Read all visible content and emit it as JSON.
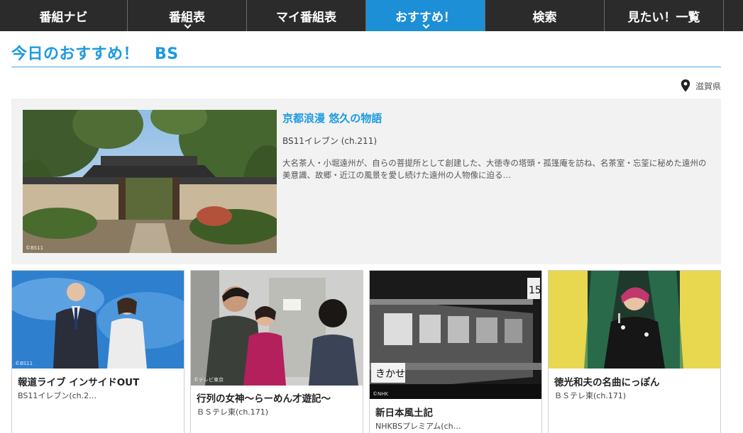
{
  "nav": {
    "items": [
      {
        "label": "番組ナビ"
      },
      {
        "label": "番組表"
      },
      {
        "label": "マイ番組表"
      },
      {
        "label": "おすすめ！"
      },
      {
        "label": "検索"
      },
      {
        "label": "見たい！一覧"
      }
    ]
  },
  "page": {
    "title": "今日のおすすめ！",
    "subtitle": "BS"
  },
  "location": {
    "label": "滋賀県"
  },
  "featured": {
    "title": "京都浪漫 悠久の物語",
    "channel": "BS11イレブン (ch.211)",
    "description": "大名茶人・小堀遠州が、自らの菩提所として創建した、大徳寺の塔頭・孤篷庵を訪ね、名茶室・忘筌に秘めた遠州の美意識、故郷・近江の風景を愛し続けた遠州の人物像に迫る…",
    "copyright": "©BS11"
  },
  "cards": [
    {
      "title": "報道ライブ インサイドOUT",
      "channel": "BS11イレブン(ch.2…",
      "copyright": "©BS11"
    },
    {
      "title": "行列の女神～らーめん才遊記～",
      "channel": "ＢＳテレ東(ch.171)",
      "copyright": "©テレビ東京"
    },
    {
      "title": "新日本風土記",
      "channel": "NHKBSプレミアム(ch…",
      "copyright": "©NHK"
    },
    {
      "title": "徳光和夫の名曲にっぽん",
      "channel": "ＢＳテレ東(ch.171)",
      "copyright": ""
    }
  ],
  "colors": {
    "nav_bg": "#2b2b2b",
    "accent": "#1c8fd6",
    "title_blue": "#1c9ae0"
  }
}
